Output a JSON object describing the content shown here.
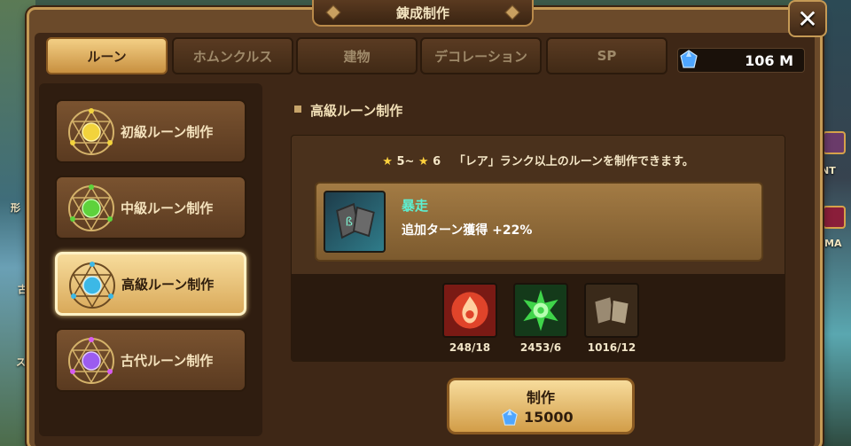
{
  "header": {
    "title": "錬成制作"
  },
  "tabs": [
    {
      "label": "ルーン",
      "active": true
    },
    {
      "label": "ホムンクルス",
      "active": false
    },
    {
      "label": "建物",
      "active": false
    },
    {
      "label": "デコレーション",
      "active": false
    },
    {
      "label": "SP",
      "active": false
    }
  ],
  "currency": {
    "icon": "crystal-icon",
    "amount": "106 M"
  },
  "sidebar": {
    "items": [
      {
        "label": "初級ルーン制作",
        "gem_color": "#f2d33c",
        "active": false
      },
      {
        "label": "中級ルーン制作",
        "gem_color": "#5ed23c",
        "active": false
      },
      {
        "label": "高級ルーン制作",
        "gem_color": "#3cb8e6",
        "active": true
      },
      {
        "label": "古代ルーン制作",
        "gem_color": "#9b5cf0",
        "active": false
      }
    ]
  },
  "main": {
    "section_title": "高級ルーン制作",
    "description": {
      "star_min": "5~",
      "star_max": "6",
      "text": "「レア」ランク以上のルーンを制作できます。"
    },
    "rune": {
      "name": "暴走",
      "effect": "追加ターン獲得 +22%"
    },
    "materials": [
      {
        "icon": "fire-essence-icon",
        "count": "248/18"
      },
      {
        "icon": "wind-essence-icon",
        "count": "2453/6"
      },
      {
        "icon": "rune-piece-icon",
        "count": "1016/12"
      }
    ],
    "craft_button": {
      "label": "制作",
      "cost": "15000"
    }
  },
  "background": {
    "labels": [
      "形",
      "古",
      "ス",
      "NT",
      "MA"
    ]
  }
}
